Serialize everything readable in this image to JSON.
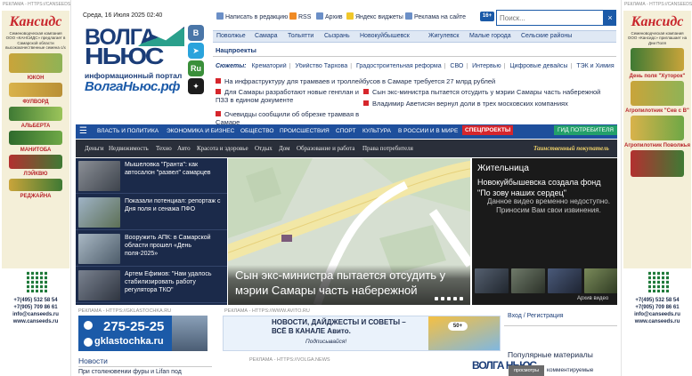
{
  "ads": {
    "tag": "РЕКЛАМА - HTTPS://CANSEEDS.RU/",
    "brand": "Кансидс",
    "left_intro": "Семеноводческая компания ООО «КАНСИДС» предлагает в Самарской области высококачественные семена с/х",
    "left_products": [
      "ЮКОН",
      "ФУЛВОРД",
      "АЛЬБЕРТА",
      "МАНИТОБА",
      "ЛЭЙКВЮ",
      "РЕДЖАЙНА"
    ],
    "right_intro": "Семеноводческая компания ООО «Кансидс» приглашает на Дни Поля",
    "right_events": [
      "День поля \"Хуторок\"",
      "Агропилотник \"Сев с В\"",
      "Агропилотник Поволжья"
    ],
    "phones": [
      "+7(495) 532 58 54",
      "+7(905) 709 86 61",
      "info@canseeds.ru",
      "www.canseeds.ru"
    ]
  },
  "header": {
    "date": "Среда, 16 Июля 2025 02:40",
    "links": [
      "Написать в редакцию",
      "RSS",
      "Архив",
      "Яндекс виджеты",
      "Реклама на сайте"
    ],
    "age": "16+",
    "search_placeholder": "Поиск..."
  },
  "logo": {
    "line1": "ВОЛГА",
    "line2": "НЬЮС",
    "subtitle": "информационный портал",
    "domain": "ВолгаНьюс.рф"
  },
  "social": [
    "В",
    "Ru"
  ],
  "cities": [
    "Поволжье",
    "Самара",
    "Тольятти",
    "Сызрань",
    "Новокуйбышевск",
    "Жигулевск",
    "Малые города",
    "Сельские районы"
  ],
  "natsproekty": "Нацпроекты",
  "sujets": {
    "label": "Сюжеты:",
    "items": [
      "Крематорий",
      "Убийство Тархова",
      "Градостроительная реформа",
      "СВО",
      "Интервью",
      "Цифровые девайсы",
      "ТЭК и Химия"
    ]
  },
  "headlines": [
    "На инфраструктуру для трамваев и троллейбусов в Самаре требуется 27 млрд рублей",
    "Для Самары разработают новые генплан и ПЗЗ в едином документе",
    "Сын экс-министра пытается отсудить у мэрии Самары часть набережной",
    "Очевидцы сообщили об обрезке трамвая в Самаре",
    "Владимир Аветисян вернул доли в трех московских компаниях"
  ],
  "mainnav": [
    "ВЛАСТЬ И ПОЛИТИКА",
    "ЭКОНОМИКА И БИЗНЕС",
    "ОБЩЕСТВО",
    "ПРОИСШЕСТВИЯ",
    "СПОРТ",
    "КУЛЬТУРА",
    "В РОССИИ И В МИРЕ",
    "СПЕЦПРОЕКТЫ",
    "ГИД ПОТРЕБИТЕЛЯ"
  ],
  "subnav": [
    "Деньги",
    "Недвижимость",
    "Техно",
    "Авто",
    "Красота и здоровье",
    "Отдых",
    "Дом",
    "Образование и работа",
    "Права потребителя",
    "Таинственный покупатель"
  ],
  "news": [
    "Мышеловка \"Гранта\": как автосалон \"развел\" самарцев",
    "Показали потенциал: репортаж с Дня поля и сенажа ПФО",
    "Вооружить АПК: в Самарской области прошел «День поля-2025»",
    "Артем Ефимов: \"Нам удалось стабилизировать работу регулятора ТКО\""
  ],
  "hero": {
    "title": "Сын экс-министра пытается отсудить у мэрии Самары часть набережной"
  },
  "video": {
    "title": "Жительница",
    "subtitle": "Новокуйбышевска создала фонд \"По зову наших сердец\"",
    "message": "Данное видео временно недоступно. Приносим Вам свои извинения.",
    "archive": "Архив видео"
  },
  "bottom_ads": {
    "gk_tag": "РЕКЛАМА - HTTPS://GKLASTOCHKA.RU",
    "gk_phone": "275-25-25",
    "gk_site": "gklastochka.ru",
    "avito_tag": "РЕКЛАМА - HTTPS://WWW.AVITO.RU",
    "avito_line1": "НОВОСТИ, ДАЙДЖЕСТЫ И СОВЕТЫ –",
    "avito_line2": "ВСЁ В КАНАЛЕ Авито.",
    "avito_line3": "Подписывайся!",
    "avito_badge": "50+",
    "volga_tag": "РЕКЛАМА - HTTPS://VOLGA.NEWS",
    "volga_logo": "ВОЛГА НЬЮС"
  },
  "auth": "Вход / Регистрация",
  "news_section": {
    "title": "Новости",
    "first": "При столкновении фуры и Lifan под"
  },
  "popular": {
    "title": "Популярные материалы",
    "tab1": "просмотры",
    "tab2": "комментируемые"
  },
  "colors": {
    "brand_blue": "#1e4f9c",
    "dark_navy": "#1b2a4a",
    "accent_red": "#d6262c",
    "consumer_green": "#23a06a"
  }
}
